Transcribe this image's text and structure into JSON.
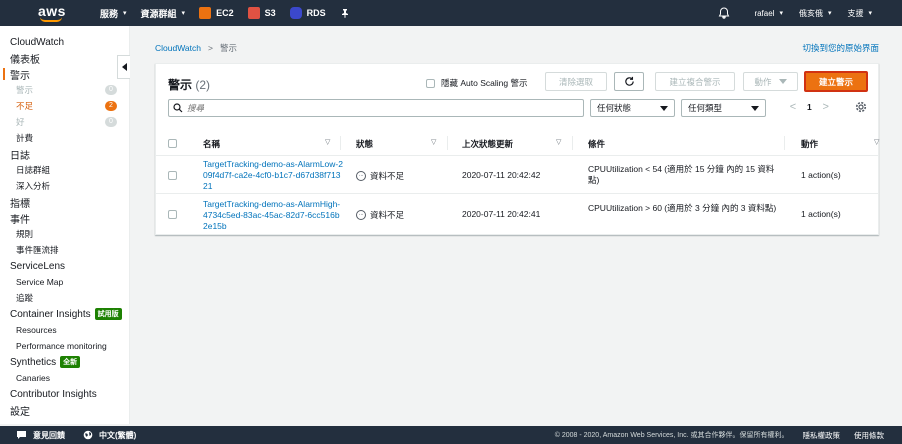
{
  "topnav": {
    "logo": "aws",
    "services": "服務",
    "resource_groups": "資源群組",
    "ec2": "EC2",
    "s3": "S3",
    "rds": "RDS",
    "user": "rafael",
    "region": "俄亥俄",
    "support": "支援"
  },
  "sidebar": {
    "items": [
      {
        "label": "CloudWatch",
        "kind": "top"
      },
      {
        "label": "儀表板",
        "kind": "top"
      },
      {
        "label": "警示",
        "kind": "top-active"
      },
      {
        "label": "警示",
        "kind": "sub-muted",
        "badge": "0"
      },
      {
        "label": "不足",
        "kind": "sub-warn",
        "badge": "2"
      },
      {
        "label": "好",
        "kind": "sub-muted",
        "badge": "0"
      },
      {
        "label": "計費",
        "kind": "sub"
      },
      {
        "label": "日誌",
        "kind": "top"
      },
      {
        "label": "日誌群組",
        "kind": "sub"
      },
      {
        "label": "深入分析",
        "kind": "sub"
      },
      {
        "label": "指標",
        "kind": "top"
      },
      {
        "label": "事件",
        "kind": "top"
      },
      {
        "label": "規則",
        "kind": "sub"
      },
      {
        "label": "事件匯流排",
        "kind": "sub"
      },
      {
        "label": "ServiceLens",
        "kind": "top"
      },
      {
        "label": "Service Map",
        "kind": "sub"
      },
      {
        "label": "追蹤",
        "kind": "sub"
      },
      {
        "label": "Container Insights",
        "kind": "top",
        "tag": "試用版"
      },
      {
        "label": "Resources",
        "kind": "sub"
      },
      {
        "label": "Performance monitoring",
        "kind": "sub"
      },
      {
        "label": "Synthetics",
        "kind": "top",
        "tag": "全新"
      },
      {
        "label": "Canaries",
        "kind": "sub"
      },
      {
        "label": "Contributor Insights",
        "kind": "top"
      },
      {
        "label": "設定",
        "kind": "top"
      }
    ]
  },
  "breadcrumb": {
    "root": "CloudWatch",
    "current": "警示"
  },
  "switch_link": "切換到您的原始界面",
  "panel": {
    "title": "警示",
    "count": "(2)",
    "hide_autoscaling": "隱藏 Auto Scaling 警示",
    "clear_selection": "清除選取",
    "create_composite": "建立複合警示",
    "actions": "動作",
    "create_alarm": "建立警示",
    "search_placeholder": "搜尋",
    "state_filter": "任何狀態",
    "type_filter": "任何類型",
    "page": "1"
  },
  "table": {
    "headers": {
      "name": "名稱",
      "state": "狀態",
      "last_update": "上次狀態更新",
      "conditions": "條件",
      "actions": "動作"
    },
    "rows": [
      {
        "name": "TargetTracking-demo-as-AlarmLow-209f4d7f-ca2e-4cf0-b1c7-d67d38f71321",
        "state": "資料不足",
        "last_update": "2020-07-11 20:42:42",
        "condition": "CPUUtilization < 54 (適用於 15 分鐘 內的 15 資料點)",
        "actions": "1 action(s)"
      },
      {
        "name": "TargetTracking-demo-as-AlarmHigh-4734c5ed-83ac-45ac-82d7-6cc516b2e15b",
        "state": "資料不足",
        "last_update": "2020-07-11 20:42:41",
        "condition": "CPUUtilization > 60 (適用於 3 分鐘 內的 3 資料點)",
        "actions": "1 action(s)"
      }
    ]
  },
  "footer": {
    "feedback": "意見回饋",
    "language": "中文(繁體)",
    "copyright": "© 2008 - 2020, Amazon Web Services, Inc. 或其合作夥伴。保留所有權利。",
    "privacy": "隱私權政策",
    "terms": "使用條款"
  },
  "colors": {
    "nav_bg": "#232f3e",
    "accent": "#ec7211",
    "link": "#0073bb",
    "ec2": "#ec7211",
    "s3": "#e05243",
    "rds": "#3b48cc"
  }
}
